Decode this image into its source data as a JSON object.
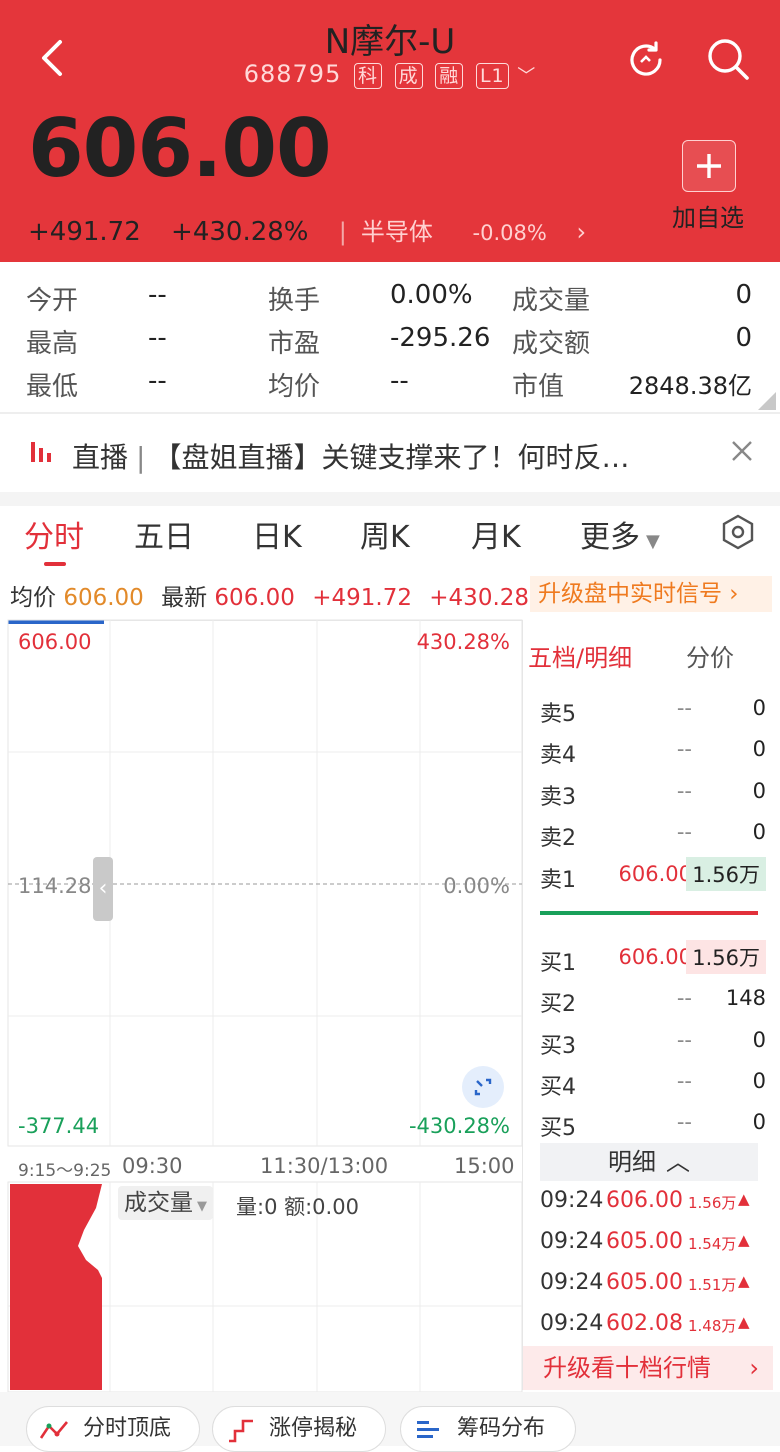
{
  "header": {
    "title": "N摩尔-U",
    "code": "688795",
    "tags": [
      "科",
      "成",
      "融",
      "L1"
    ],
    "price": "606.00",
    "change": "+491.72",
    "change_pct": "+430.28%",
    "sector": "半导体",
    "sector_change": "-0.08%",
    "add_watch_label": "加自选",
    "bg_color": "#e4363b"
  },
  "stats": {
    "open_label": "今开",
    "open": "--",
    "high_label": "最高",
    "high": "--",
    "low_label": "最低",
    "low": "--",
    "turnover_label": "换手",
    "turnover": "0.00%",
    "pe_label": "市盈",
    "pe": "-295.26",
    "avg_label": "均价",
    "avg": "--",
    "volume_label": "成交量",
    "volume": "0",
    "amount_label": "成交额",
    "amount": "0",
    "mcap_label": "市值",
    "mcap": "2848.38亿"
  },
  "live": {
    "tag": "直播",
    "text": "【盘姐直播】关键支撑来了！何时反…"
  },
  "tabs": [
    "分时",
    "五日",
    "日K",
    "周K",
    "月K",
    "更多"
  ],
  "info": {
    "avg_label": "均价",
    "avg_value": "606.00",
    "latest_label": "最新",
    "latest_value": "606.00",
    "change": "+491.72",
    "change_pct": "+430.28%",
    "upgrade_signal": "升级盘中实时信号"
  },
  "chart": {
    "y_top": "606.00",
    "y_mid": "114.28",
    "y_bot": "-377.44",
    "pct_top": "430.28%",
    "pct_mid": "0.00%",
    "pct_bot": "-430.28%",
    "time_pre": "9:15～9:25",
    "time_open": "09:30",
    "time_mid": "11:30/13:00",
    "time_close": "15:00",
    "volume_selector": "成交量",
    "volume_info": "量:0 额:0.00"
  },
  "order_book": {
    "tab_active": "五档/明细",
    "tab_other": "分价",
    "sells": [
      {
        "label": "卖5",
        "price": "--",
        "vol": "0"
      },
      {
        "label": "卖4",
        "price": "--",
        "vol": "0"
      },
      {
        "label": "卖3",
        "price": "--",
        "vol": "0"
      },
      {
        "label": "卖2",
        "price": "--",
        "vol": "0"
      },
      {
        "label": "卖1",
        "price": "606.00",
        "vol": "1.56万"
      }
    ],
    "buys": [
      {
        "label": "买1",
        "price": "606.00",
        "vol": "1.56万"
      },
      {
        "label": "买2",
        "price": "--",
        "vol": "148"
      },
      {
        "label": "买3",
        "price": "--",
        "vol": "0"
      },
      {
        "label": "买4",
        "price": "--",
        "vol": "0"
      },
      {
        "label": "买5",
        "price": "--",
        "vol": "0"
      }
    ],
    "detail_label": "明细",
    "ticks": [
      {
        "time": "09:24",
        "price": "606.00",
        "vol": "1.56万"
      },
      {
        "time": "09:24",
        "price": "605.00",
        "vol": "1.54万"
      },
      {
        "time": "09:24",
        "price": "605.00",
        "vol": "1.51万"
      },
      {
        "time": "09:24",
        "price": "602.08",
        "vol": "1.48万"
      }
    ],
    "upgrade_ten": "升级看十档行情"
  },
  "bottom": {
    "btn1": "分时顶底",
    "btn2": "涨停揭秘",
    "btn3": "筹码分布"
  }
}
